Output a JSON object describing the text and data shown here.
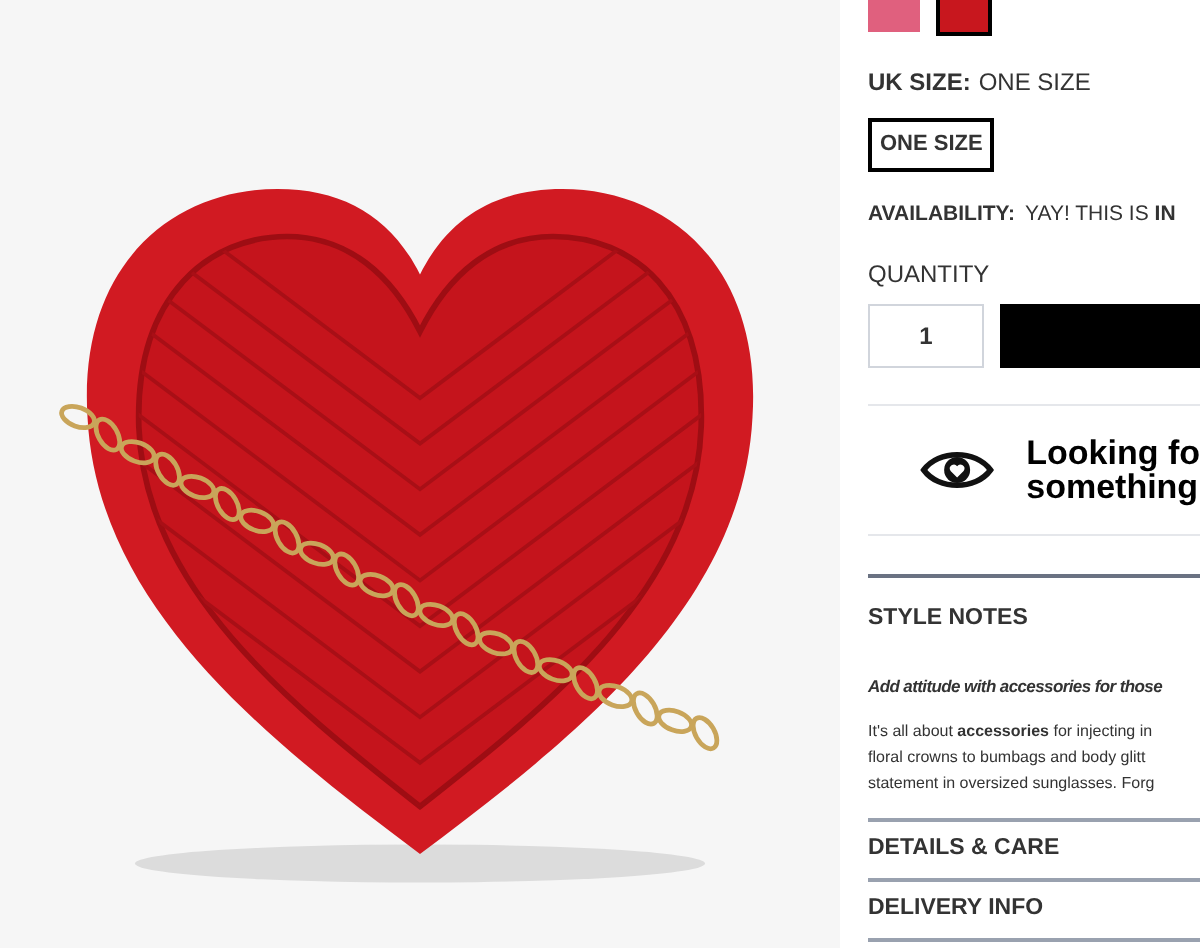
{
  "swatches": [
    {
      "color": "#e0607e",
      "selected": false
    },
    {
      "color": "#c8171e",
      "selected": true
    }
  ],
  "size": {
    "label": "UK SIZE:",
    "value": "ONE SIZE",
    "options": [
      {
        "label": "ONE SIZE",
        "selected": true
      }
    ]
  },
  "availability": {
    "label": "AVAILABILITY:",
    "value": "YAY! THIS IS **IN**"
  },
  "quantity": {
    "label": "QUANTITY",
    "value": "1"
  },
  "promo": {
    "lines": [
      "Looking fo",
      "something"
    ]
  },
  "style_notes": {
    "title": "STYLE NOTES",
    "intro": "Add attitude with accessories for those",
    "body": [
      "It's all about **accessories** for injecting in",
      "floral crowns to bumbags and body glitt",
      "statement in oversized sunglasses. Forg"
    ]
  },
  "sections": [
    {
      "title": "DETAILS & CARE",
      "expanded": false
    },
    {
      "title": "DELIVERY INFO",
      "expanded": false
    }
  ]
}
